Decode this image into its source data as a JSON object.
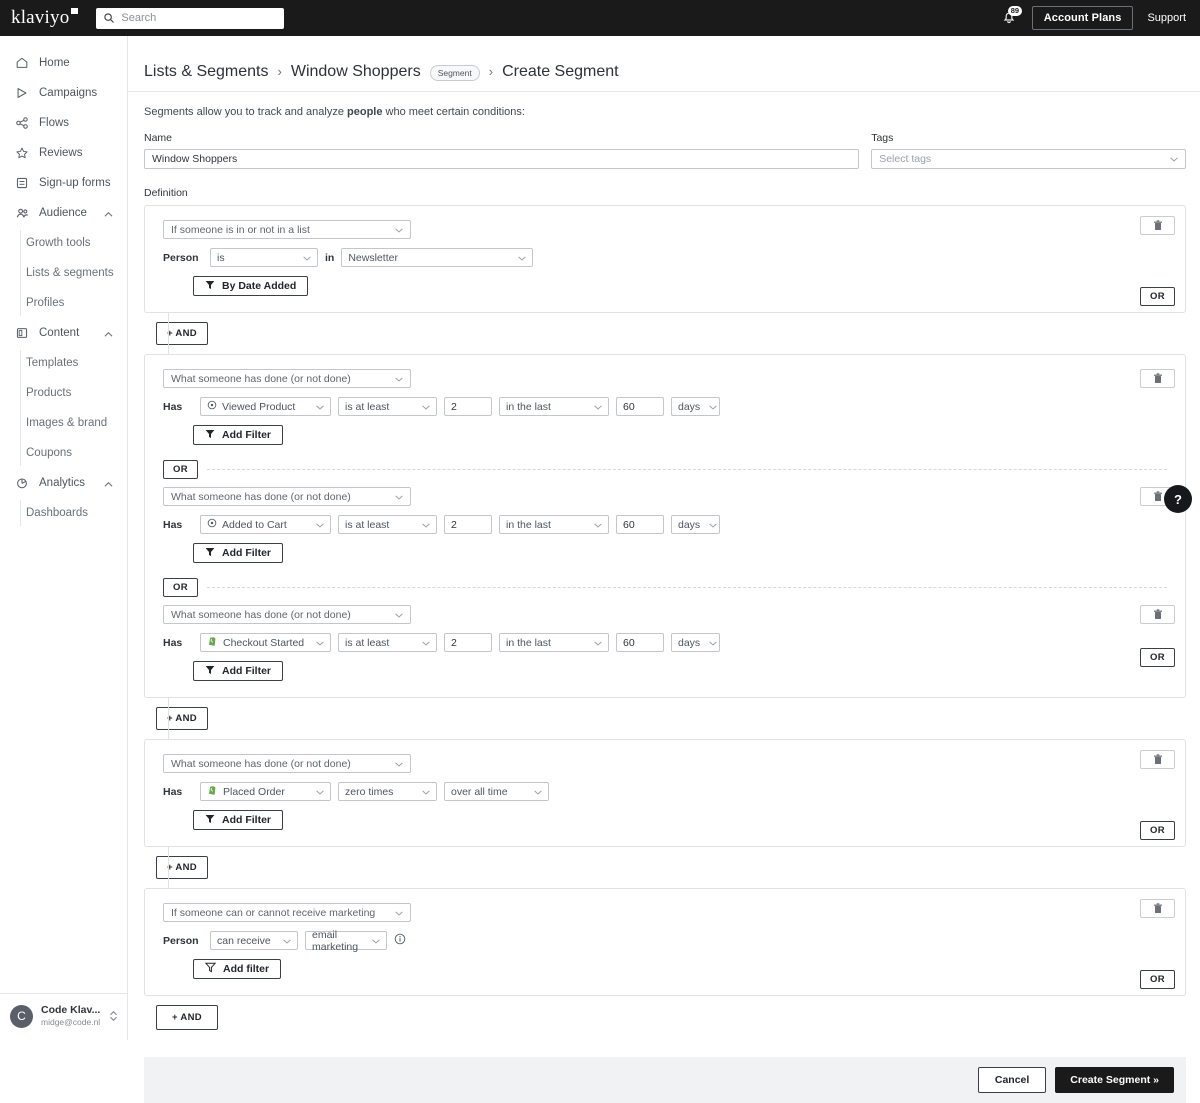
{
  "topbar": {
    "logo": "klaviyo",
    "search_placeholder": "Search",
    "notifications_count": "89",
    "account_plans_label": "Account Plans",
    "support_label": "Support"
  },
  "sidebar": {
    "items": [
      {
        "label": "Home",
        "icon": "home-icon"
      },
      {
        "label": "Campaigns",
        "icon": "campaigns-icon"
      },
      {
        "label": "Flows",
        "icon": "flows-icon"
      },
      {
        "label": "Reviews",
        "icon": "star-icon"
      },
      {
        "label": "Sign-up forms",
        "icon": "form-icon"
      }
    ],
    "groups": [
      {
        "label": "Audience",
        "icon": "audience-icon",
        "children": [
          "Growth tools",
          "Lists & segments",
          "Profiles"
        ]
      },
      {
        "label": "Content",
        "icon": "content-icon",
        "children": [
          "Templates",
          "Products",
          "Images & brand",
          "Coupons"
        ]
      },
      {
        "label": "Analytics",
        "icon": "analytics-icon",
        "children": [
          "Dashboards"
        ]
      }
    ],
    "account": {
      "initial": "C",
      "name": "Code Klav...",
      "email": "midge@code.nl"
    }
  },
  "breadcrumb": {
    "root": "Lists & Segments",
    "parent": "Window Shoppers",
    "pill": "Segment",
    "current": "Create Segment",
    "separator": "›"
  },
  "intro": {
    "before": "Segments allow you to track and analyze ",
    "bold": "people",
    "after": " who meet certain conditions:"
  },
  "form": {
    "name_label": "Name",
    "name_value": "Window Shoppers",
    "tags_label": "Tags",
    "tags_placeholder": "Select tags",
    "definition_label": "Definition"
  },
  "labels": {
    "or": "OR",
    "and": "+ AND",
    "add_filter": "Add Filter",
    "add_filter_lower": "Add filter",
    "by_date_added": "By Date Added",
    "has": "Has",
    "person": "Person",
    "in": "in"
  },
  "blocks": [
    {
      "id": "block-list-membership",
      "trigger": "If someone is in or not in a list",
      "prefix": "Person",
      "operator": "is",
      "joiner": "in",
      "list_value": "Newsletter",
      "filter_button": "By Date Added"
    },
    {
      "id": "block-browse-activity",
      "subs": [
        {
          "trigger": "What someone has done (or not done)",
          "prefix": "Has",
          "metric": "Viewed Product",
          "metric_icon": "target-icon",
          "comparator": "is at least",
          "count": "2",
          "timeframe": "in the last",
          "number": "60",
          "unit": "days",
          "filter_button": "Add Filter"
        },
        {
          "trigger": "What someone has done (or not done)",
          "prefix": "Has",
          "metric": "Added to Cart",
          "metric_icon": "target-icon",
          "comparator": "is at least",
          "count": "2",
          "timeframe": "in the last",
          "number": "60",
          "unit": "days",
          "filter_button": "Add Filter"
        },
        {
          "trigger": "What someone has done (or not done)",
          "prefix": "Has",
          "metric": "Checkout Started",
          "metric_icon": "shopify-icon",
          "comparator": "is at least",
          "count": "2",
          "timeframe": "in the last",
          "number": "60",
          "unit": "days",
          "filter_button": "Add Filter"
        }
      ]
    },
    {
      "id": "block-placed-order",
      "trigger": "What someone has done (or not done)",
      "prefix": "Has",
      "metric": "Placed Order",
      "metric_icon": "shopify-icon",
      "comparator": "zero times",
      "timeframe": "over all time",
      "filter_button": "Add Filter"
    },
    {
      "id": "block-marketing-consent",
      "trigger": "If someone can or cannot receive marketing",
      "prefix": "Person",
      "operator": "can receive",
      "channel": "email marketing",
      "info_icon": "info-icon",
      "filter_button": "Add filter"
    }
  ],
  "footer": {
    "cancel_label": "Cancel",
    "submit_label": "Create Segment »"
  },
  "help": {
    "label": "?"
  },
  "colors": {
    "topbar_bg": "#1a1a1a",
    "accent_dark": "#1a1a1a",
    "shopify_green": "#5e8e3e",
    "footer_bg": "#f1f2f4",
    "border": "#e0e2e5"
  }
}
